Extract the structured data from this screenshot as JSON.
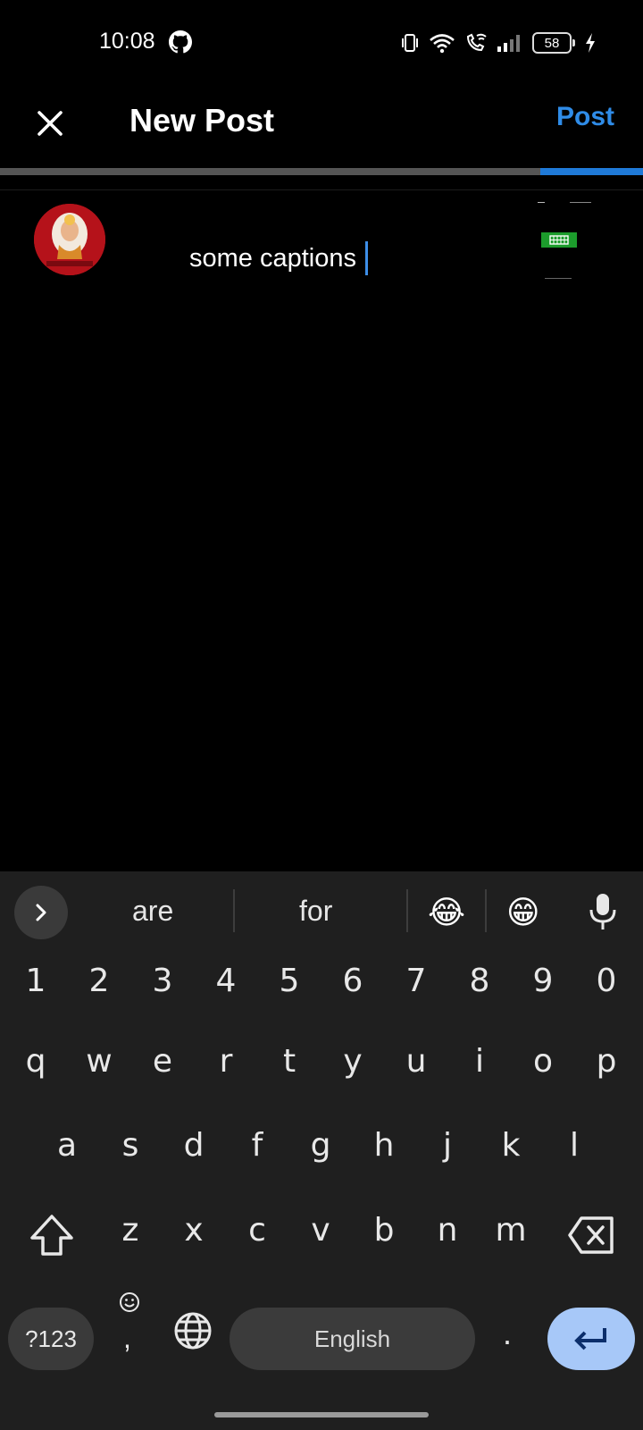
{
  "status_bar": {
    "time": "10:08",
    "battery": "58",
    "icons": [
      "github-icon",
      "vibrate-icon",
      "wifi-icon",
      "wifi-calling-icon",
      "signal-icon",
      "battery-icon",
      "charging-icon"
    ]
  },
  "app_bar": {
    "title": "New Post",
    "post_label": "Post",
    "close_icon": "close-icon"
  },
  "upload_progress": 0.16,
  "colors": {
    "accent": "#2f8ce8",
    "background": "#000000",
    "keyboard_bg": "#1f1f1f",
    "enter_key": "#a7c8f8"
  },
  "compose": {
    "caption": "some captions"
  },
  "keyboard": {
    "suggestions": [
      "are",
      "for"
    ],
    "emoji_suggestions": [
      "😂",
      "😁"
    ],
    "numbers": [
      "1",
      "2",
      "3",
      "4",
      "5",
      "6",
      "7",
      "8",
      "9",
      "0"
    ],
    "row1": [
      "q",
      "w",
      "e",
      "r",
      "t",
      "y",
      "u",
      "i",
      "o",
      "p"
    ],
    "row2": [
      "a",
      "s",
      "d",
      "f",
      "g",
      "h",
      "j",
      "k",
      "l"
    ],
    "row3": [
      "z",
      "x",
      "c",
      "v",
      "b",
      "n",
      "m"
    ],
    "symbols_label": "?123",
    "emoji_key_comma": ",",
    "space_label": "English",
    "period": "."
  }
}
